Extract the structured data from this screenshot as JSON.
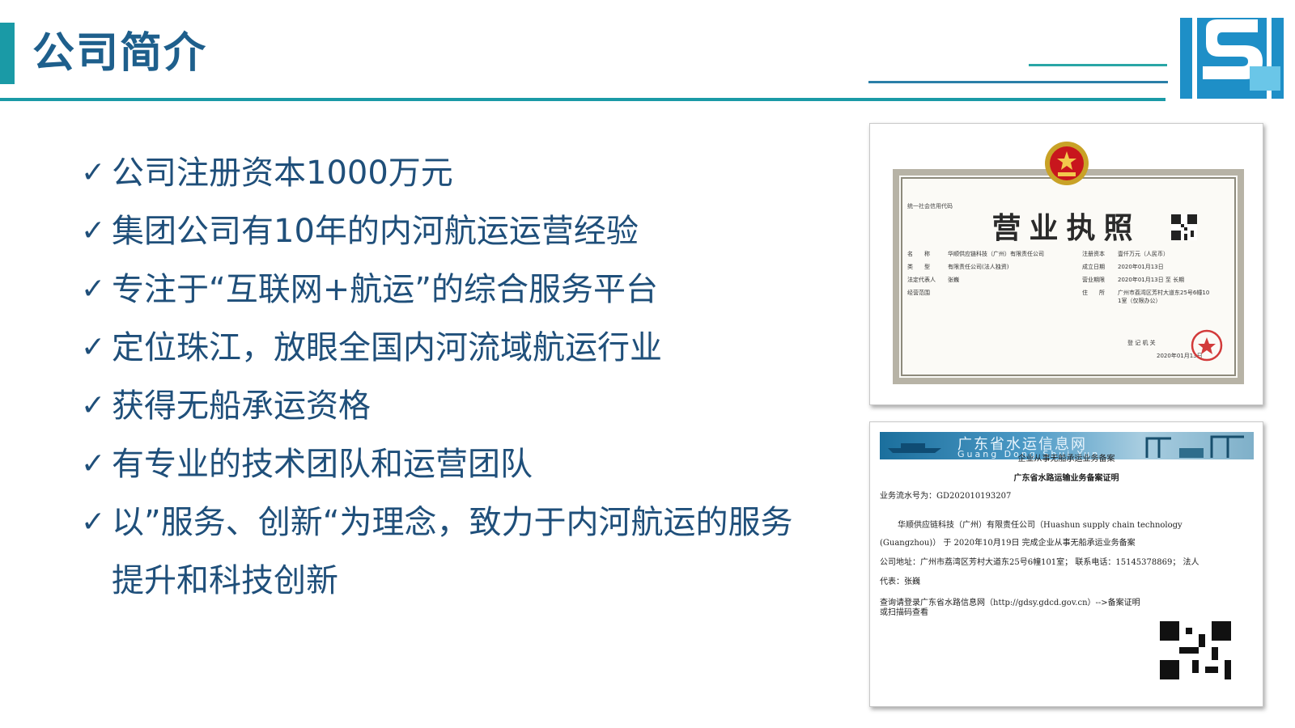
{
  "header": {
    "title": "公司简介"
  },
  "bullets": [
    "公司注册资本1000万元",
    "集团公司有10年的内河航运运营经验",
    "专注于“互联网+航运”的综合服务平台",
    "定位珠江，放眼全国内河流域航运行业",
    "获得无船承运资格",
    "有专业的技术团队和运营团队",
    "以”服务、创新“为理念，致力于内河航运的服务提升和科技创新"
  ],
  "check_glyph": "✓",
  "license": {
    "title": "营业执照",
    "code_label": "统一社会信用代码",
    "fields": {
      "name_label": "名　　称",
      "name_value": "华顺供应链科技（广州）有限责任公司",
      "type_label": "类　　型",
      "type_value": "有限责任公司(法人独资)",
      "rep_label": "法定代表人",
      "rep_value": "张巍",
      "scope_label": "经营范围",
      "capital_label": "注册资本",
      "capital_value": "壹仟万元（人民币）",
      "date_label": "成立日期",
      "date_value": "2020年01月13日",
      "term_label": "营业期限",
      "term_value": "2020年01月13日 至 长期",
      "addr_label": "住　　所",
      "addr_value": "广州市荔湾区芳村大道东25号6幢10",
      "addr_value2": "1室（仅限办公）",
      "reg_label": "登 记 机 关",
      "reg_date": "2020年01月13日"
    }
  },
  "record": {
    "banner_cn": "广东省水运信息网",
    "banner_en": "Guang Dong Shui Yun",
    "heading1": "企业从事无船承运业务备案",
    "heading2": "广东省水路运输业务备案证明",
    "serial": "业务流水号为：GD202010193207",
    "line1": "华顺供应链科技（广州）有限责任公司（Huashun supply chain technology",
    "line2": "(Guangzhou)） 于 2020年10月19日 完成企业从事无船承运业务备案",
    "line3": "公司地址：广州市荔湾区芳村大道东25号6幢101室； 联系电话：15145378869； 法人",
    "line4": "代表：张巍",
    "line5": "查询请登录广东省水路信息网（http://gdsy.gdcd.gov.cn）-->备案证明",
    "line6": "或扫描码查看"
  },
  "colors": {
    "title": "#1e5f8c",
    "accent": "#1a9aa6",
    "text": "#1f4f7a"
  }
}
